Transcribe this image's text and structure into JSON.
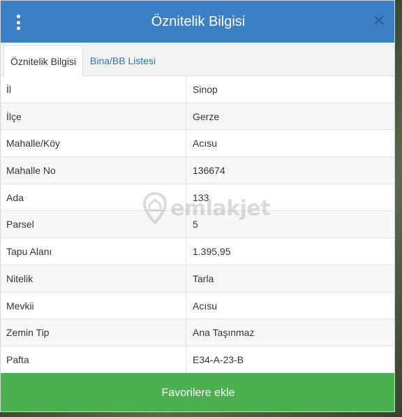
{
  "header": {
    "title": "Öznitelik Bilgisi"
  },
  "tabs": [
    {
      "label": "Öznitelik Bilgisi",
      "active": true
    },
    {
      "label": "Bina/BB Listesi",
      "active": false
    }
  ],
  "rows": [
    {
      "key": "İl",
      "value": "Sinop"
    },
    {
      "key": "İlçe",
      "value": "Gerze"
    },
    {
      "key": "Mahalle/Köy",
      "value": "Acısu"
    },
    {
      "key": "Mahalle No",
      "value": "136674"
    },
    {
      "key": "Ada",
      "value": "133"
    },
    {
      "key": "Parsel",
      "value": "5"
    },
    {
      "key": "Tapu Alanı",
      "value": "1.395,95"
    },
    {
      "key": "Nitelik",
      "value": "Tarla"
    },
    {
      "key": "Mevkii",
      "value": "Acısu"
    },
    {
      "key": "Zemin Tip",
      "value": "Ana Taşınmaz"
    },
    {
      "key": "Pafta",
      "value": "E34-A-23-B"
    }
  ],
  "footer": {
    "button_label": "Favorilere ekle"
  },
  "watermark": {
    "text": "emlakjet"
  },
  "icons": {
    "menu": "more-vertical-icon",
    "close": "close-icon",
    "watermark": "location-pin-icon"
  },
  "colors": {
    "header": "#3b7fc4",
    "button": "#4caf50",
    "tab_link": "#2f6fb0"
  }
}
